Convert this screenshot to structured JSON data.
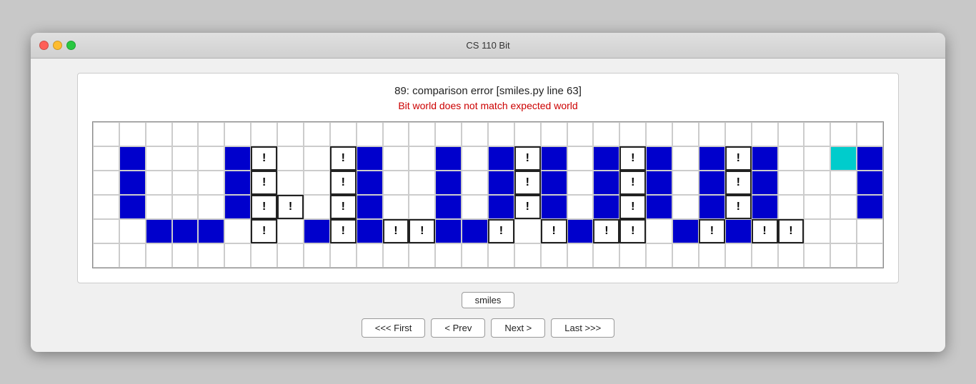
{
  "window": {
    "title": "CS 110 Bit"
  },
  "error": {
    "title": "89: comparison error  [smiles.py line 63]",
    "subtitle": "Bit world does not match expected world"
  },
  "label": "smiles",
  "buttons": {
    "first": "<<< First",
    "prev": "< Prev",
    "next": "Next >",
    "last": "Last >>>"
  },
  "grid": {
    "rows": 6,
    "cols": 30,
    "cells": [
      "w",
      "w",
      "w",
      "w",
      "w",
      "w",
      "w",
      "w",
      "w",
      "w",
      "w",
      "w",
      "w",
      "w",
      "w",
      "w",
      "w",
      "w",
      "w",
      "w",
      "w",
      "w",
      "w",
      "w",
      "w",
      "w",
      "w",
      "w",
      "w",
      "w",
      "w",
      "b",
      "w",
      "w",
      "w",
      "b",
      "e",
      "e",
      "w",
      "e",
      "b",
      "w",
      "w",
      "b",
      "w",
      "b",
      "e",
      "b",
      "w",
      "b",
      "e",
      "b",
      "w",
      "w",
      "w",
      "e",
      "w",
      "w",
      "e",
      "b",
      "w",
      "b",
      "w",
      "w",
      "w",
      "b",
      "w",
      "w",
      "w",
      "w",
      "b",
      "w",
      "w",
      "b",
      "w",
      "b",
      "w",
      "b",
      "w",
      "b",
      "w",
      "b",
      "w",
      "w",
      "w",
      "w",
      "w",
      "w",
      "w",
      "b",
      "w",
      "b",
      "w",
      "w",
      "w",
      "b",
      "e",
      "e",
      "w",
      "e",
      "b",
      "w",
      "w",
      "b",
      "w",
      "b",
      "e",
      "b",
      "w",
      "b",
      "e",
      "b",
      "w",
      "w",
      "w",
      "e",
      "w",
      "w",
      "w",
      "w",
      "w",
      "w",
      "b",
      "b",
      "b",
      "w",
      "e",
      "w",
      "b",
      "e",
      "b",
      "e",
      "e",
      "b",
      "b",
      "e",
      "w",
      "e",
      "b",
      "e",
      "e",
      "w",
      "b",
      "e",
      "b",
      "e",
      "e",
      "w",
      "w",
      "w",
      "w",
      "w",
      "w",
      "w",
      "w",
      "w",
      "w",
      "w",
      "w",
      "w",
      "w",
      "w",
      "w",
      "w",
      "w",
      "w",
      "w",
      "w",
      "w",
      "w",
      "w",
      "w",
      "w",
      "w",
      "w",
      "w",
      "w",
      "w",
      "w",
      "w"
    ]
  }
}
